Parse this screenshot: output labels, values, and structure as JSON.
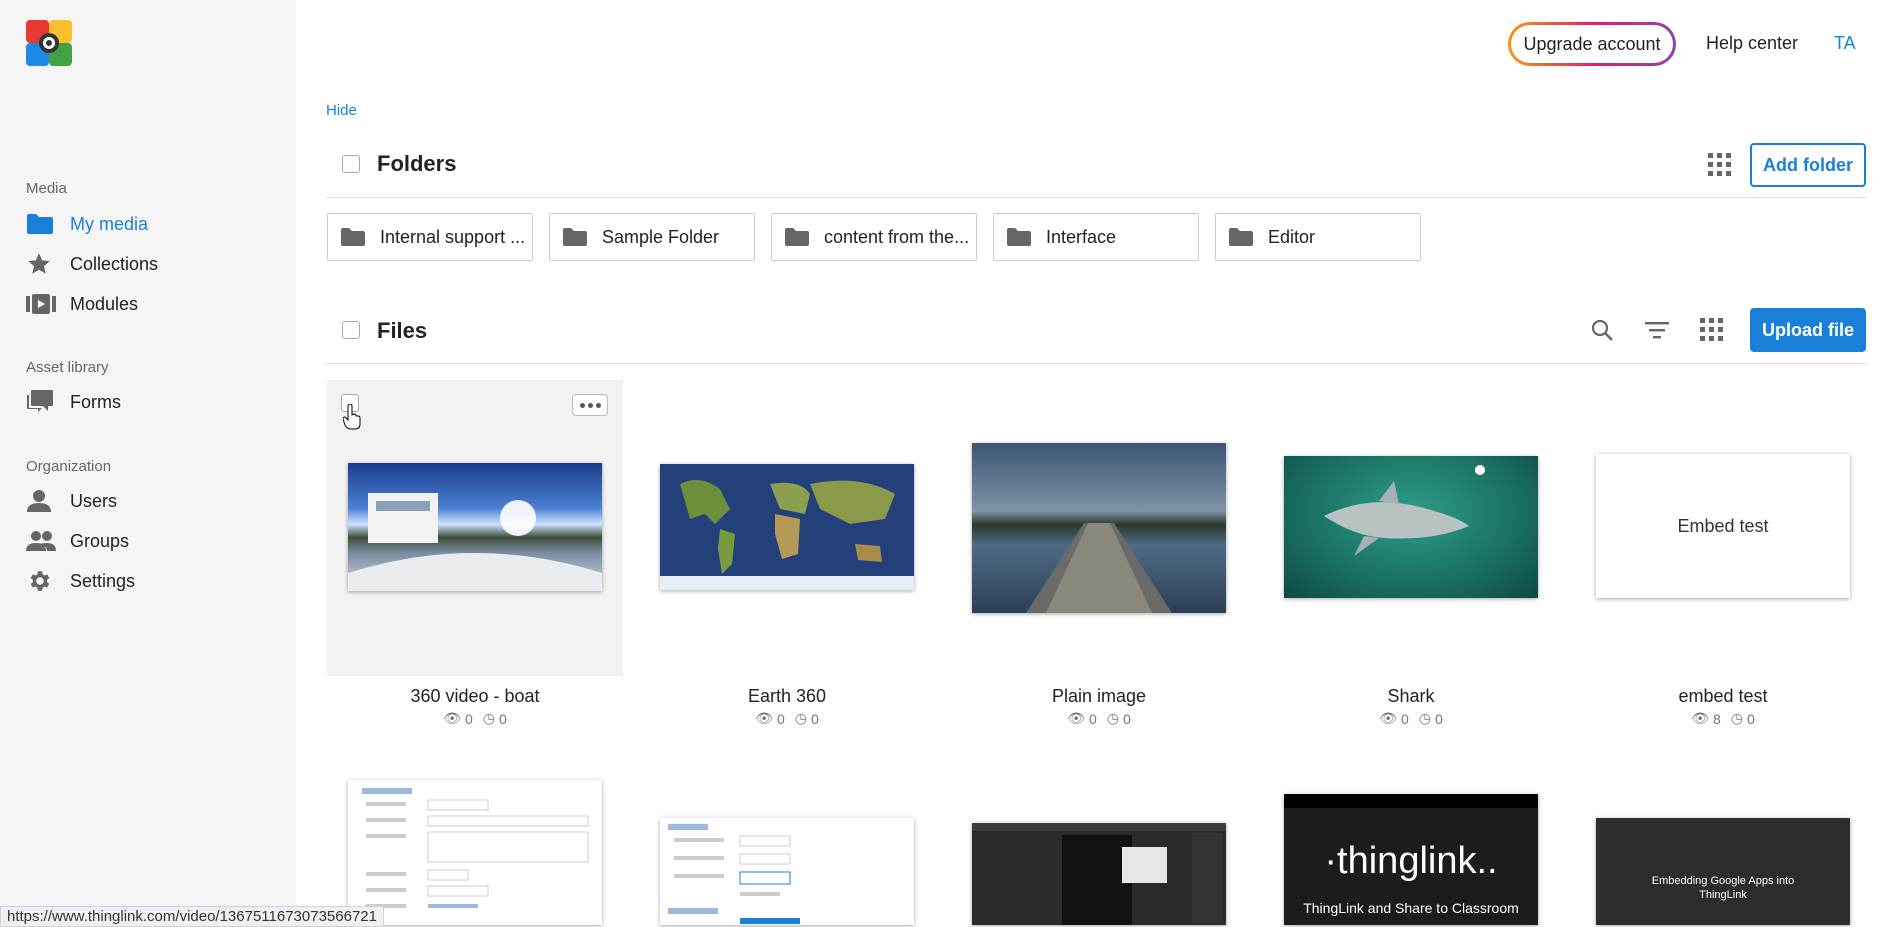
{
  "header": {
    "upgrade_label": "Upgrade account",
    "help_label": "Help center",
    "avatar_initials": "TA"
  },
  "sidebar": {
    "sections": [
      {
        "title": "Media",
        "items": [
          {
            "label": "My media",
            "icon": "folder-icon",
            "active": true
          },
          {
            "label": "Collections",
            "icon": "star-icon"
          },
          {
            "label": "Modules",
            "icon": "video-module-icon"
          }
        ]
      },
      {
        "title": "Asset library",
        "items": [
          {
            "label": "Forms",
            "icon": "forms-icon"
          }
        ]
      },
      {
        "title": "Organization",
        "items": [
          {
            "label": "Users",
            "icon": "user-icon"
          },
          {
            "label": "Groups",
            "icon": "groups-icon"
          },
          {
            "label": "Settings",
            "icon": "gear-icon"
          }
        ]
      }
    ]
  },
  "main": {
    "hide_label": "Hide",
    "folders": {
      "title": "Folders",
      "add_label": "Add folder",
      "items": [
        "Internal support ...",
        "Sample Folder",
        "content from the...",
        "Interface",
        "Editor"
      ]
    },
    "files": {
      "title": "Files",
      "upload_label": "Upload file",
      "items": [
        {
          "name": "360 video - boat",
          "views": "0",
          "time": "0"
        },
        {
          "name": "Earth 360",
          "views": "0",
          "time": "0"
        },
        {
          "name": "Plain image",
          "views": "0",
          "time": "0"
        },
        {
          "name": "Shark",
          "views": "0",
          "time": "0"
        },
        {
          "name": "embed test",
          "views": "8",
          "time": "0",
          "thumb_text": "Embed test"
        }
      ],
      "row2_thumb_texts": {
        "thinglink_logo": "·thinglink..",
        "thinglink_caption": "ThingLink and Share to Classroom",
        "google_apps": "Embedding Google Apps into ThingLink"
      }
    }
  },
  "status_bar": {
    "url": "https://www.thinglink.com/video/1367511673073566721"
  },
  "colors": {
    "accent": "#1a7fd8",
    "sidebar_bg": "#f5f5f5"
  }
}
